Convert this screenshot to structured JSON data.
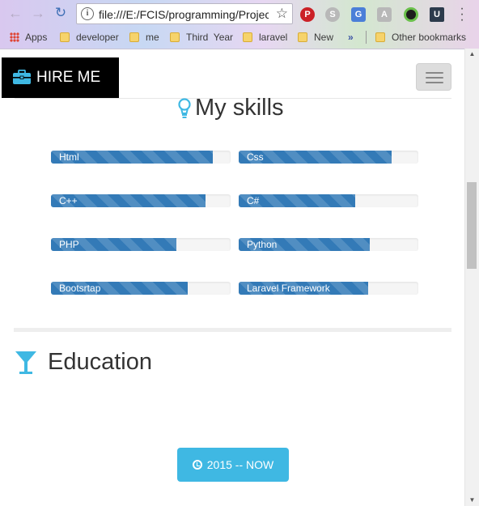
{
  "browser": {
    "url": "file:///E:/FCIS/programming/Projects",
    "bookmarks": [
      {
        "label": "Apps",
        "type": "apps"
      },
      {
        "label": "developer",
        "type": "folder"
      },
      {
        "label": "me",
        "type": "folder"
      },
      {
        "label": "Third  Year",
        "type": "folder"
      },
      {
        "label": "laravel",
        "type": "folder"
      },
      {
        "label": "New",
        "type": "folder"
      }
    ],
    "overflow_label": "»",
    "other_bookmarks": "Other bookmarks",
    "extensions": [
      {
        "icon": "pinterest-icon",
        "glyph": "P",
        "color": "#cb2027"
      },
      {
        "icon": "skype-icon",
        "glyph": "S",
        "color": "#b8b8b8"
      },
      {
        "icon": "google-translate-icon",
        "glyph": "G",
        "color": "#4a7fd8"
      },
      {
        "icon": "pdf-icon",
        "glyph": "A",
        "color": "#b8b8b8"
      },
      {
        "icon": "color-picker-icon",
        "glyph": "",
        "color": "#1d1d1d"
      },
      {
        "icon": "udemy-icon",
        "glyph": "U",
        "color": "#2c3b4c"
      }
    ]
  },
  "site": {
    "brand": "HIRE ME",
    "skills_title": "My skills",
    "skills": [
      {
        "label": "Html",
        "level": 0.9
      },
      {
        "label": "Css",
        "level": 0.85
      },
      {
        "label": "C++",
        "level": 0.86
      },
      {
        "label": "C#",
        "level": 0.65
      },
      {
        "label": "PHP",
        "level": 0.7
      },
      {
        "label": "Python",
        "level": 0.73
      },
      {
        "label": "Bootsrtap",
        "level": 0.76
      },
      {
        "label": "Laravel Framework",
        "level": 0.72
      }
    ],
    "education_title": "Education",
    "education_period": "2015 -- NOW"
  },
  "colors": {
    "progress": "#337ab7",
    "accent_cyan": "#3fb8e3",
    "brand_bg": "#000000"
  }
}
